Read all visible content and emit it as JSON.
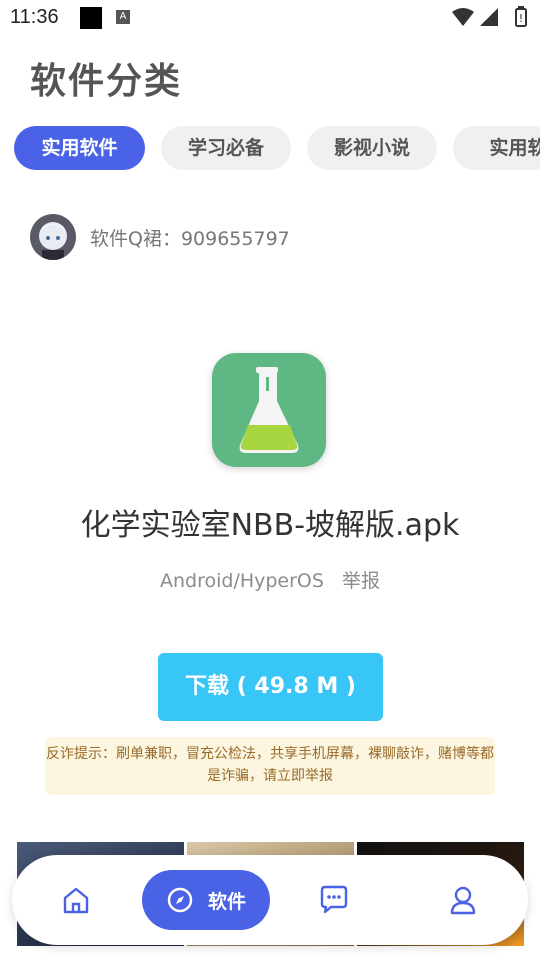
{
  "status_bar": {
    "time": "11:36",
    "a_icon": "A"
  },
  "page": {
    "title": "软件分类"
  },
  "tabs": [
    {
      "label": "实用软件",
      "active": true
    },
    {
      "label": "学习必备",
      "active": false
    },
    {
      "label": "影视小说",
      "active": false
    },
    {
      "label": "实用软",
      "active": false
    }
  ],
  "group": {
    "text": "软件Q裙：909655797"
  },
  "app": {
    "name": "化学实验室NBB-坡解版.apk",
    "platform": "Android/HyperOS",
    "report_label": "举报",
    "download_label": "下载 ( 49.8 M )"
  },
  "warning": {
    "text": "反诈提示：刷单兼职，冒充公检法，共享手机屏幕，裸聊敲诈，赌博等都是诈骗，请立即举报"
  },
  "bottom_nav": {
    "items": [
      {
        "icon": "home-icon"
      },
      {
        "icon": "compass-icon",
        "label": "软件",
        "active": true
      },
      {
        "icon": "chat-icon"
      },
      {
        "icon": "profile-icon"
      }
    ]
  },
  "colors": {
    "accent": "#4a63e6",
    "download": "#38c6f7",
    "app_icon_bg": "#5fb884",
    "warning_bg": "#fcf6e1"
  }
}
